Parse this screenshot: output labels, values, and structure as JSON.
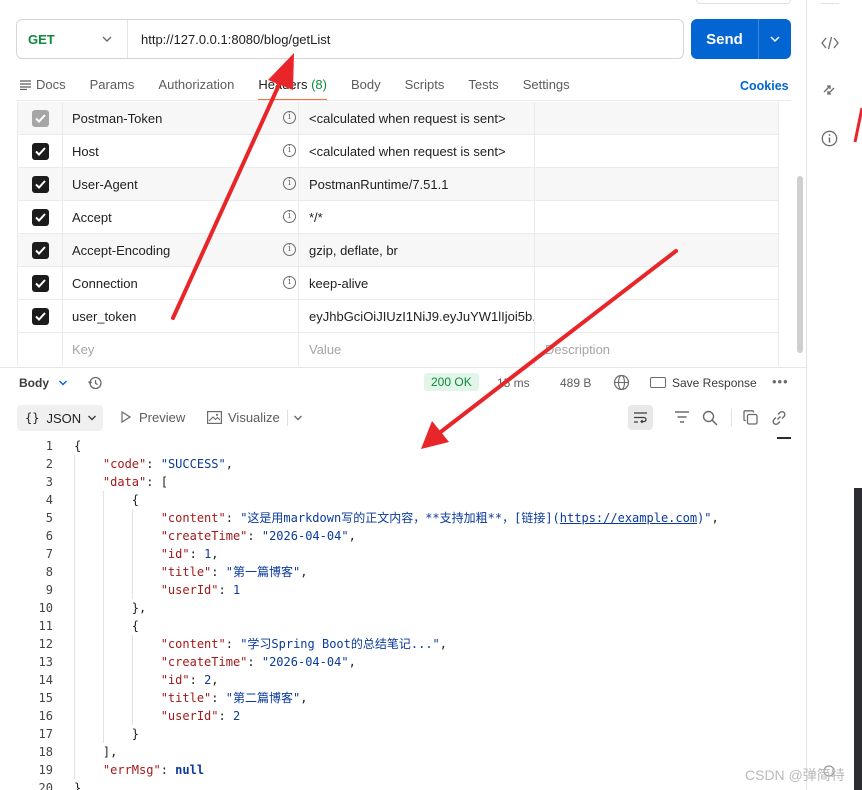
{
  "request": {
    "method": "GET",
    "url": "http://127.0.0.1:8080/blog/getList",
    "send_label": "Send"
  },
  "tabs": {
    "docs": "Docs",
    "params": "Params",
    "authorization": "Authorization",
    "headers": "Headers",
    "headers_count": "(8)",
    "body": "Body",
    "scripts": "Scripts",
    "tests": "Tests",
    "settings": "Settings",
    "cookies": "Cookies"
  },
  "headers": [
    {
      "key": "Postman-Token",
      "value": "<calculated when request is sent>",
      "enabled": true,
      "auto": true
    },
    {
      "key": "Host",
      "value": "<calculated when request is sent>",
      "enabled": true,
      "auto": true
    },
    {
      "key": "User-Agent",
      "value": "PostmanRuntime/7.51.1",
      "enabled": true,
      "auto": true
    },
    {
      "key": "Accept",
      "value": "*/*",
      "enabled": true,
      "auto": true
    },
    {
      "key": "Accept-Encoding",
      "value": "gzip, deflate, br",
      "enabled": true,
      "auto": true
    },
    {
      "key": "Connection",
      "value": "keep-alive",
      "enabled": true,
      "auto": true
    },
    {
      "key": "user_token",
      "value": "eyJhbGciOiJIUzI1NiJ9.eyJuYW1lIjoi5b...",
      "enabled": true,
      "auto": false
    }
  ],
  "headers_placeholder": {
    "key": "Key",
    "value": "Value",
    "description": "Description"
  },
  "response": {
    "section_label": "Body",
    "status": "200 OK",
    "time": "15 ms",
    "size": "489 B",
    "save_label": "Save Response",
    "format": "JSON",
    "preview": "Preview",
    "visualize": "Visualize"
  },
  "code_lines": [
    "{",
    "    \"code\": \"SUCCESS\",",
    "    \"data\": [",
    "        {",
    "            \"content\": \"这是用markdown写的正文内容，**支持加粗**，[链接](https://example.com)\",",
    "            \"createTime\": \"2026-04-04\",",
    "            \"id\": 1,",
    "            \"title\": \"第一篇博客\",",
    "            \"userId\": 1",
    "        },",
    "        {",
    "            \"content\": \"学习Spring Boot的总结笔记...\",",
    "            \"createTime\": \"2026-04-04\",",
    "            \"id\": 2,",
    "            \"title\": \"第二篇博客\",",
    "            \"userId\": 2",
    "        }",
    "    ],",
    "    \"errMsg\": null",
    "}"
  ],
  "watermark": "CSDN @弹简特",
  "icons": {
    "code_icon": "code-icon",
    "related_icon": "related-icon",
    "info_icon": "info-icon"
  },
  "colors": {
    "method_get": "#0f8a3c",
    "send_button": "#0265d2",
    "active_tab_underline": "#ff6c37",
    "status_ok_bg": "#e1f5e8",
    "annotation_arrow": "#e8262a"
  }
}
